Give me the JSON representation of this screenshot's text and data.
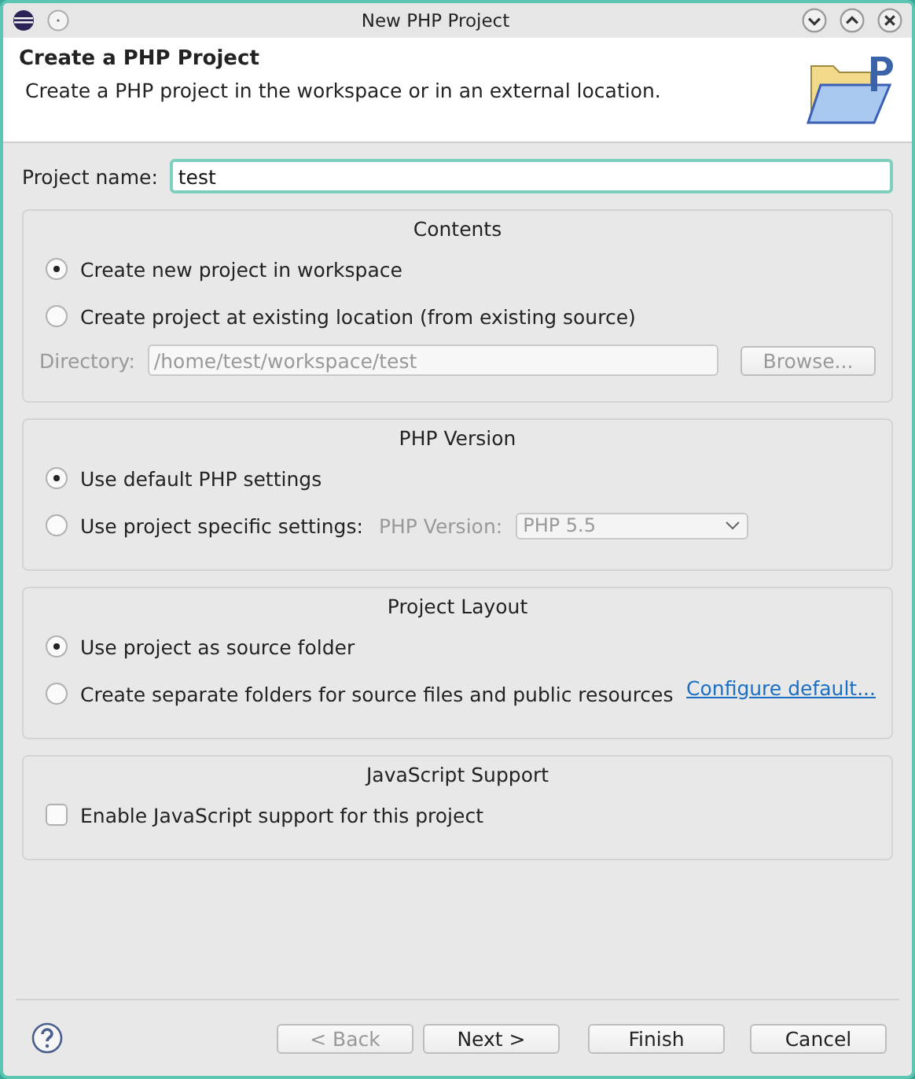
{
  "window": {
    "title": "New PHP Project"
  },
  "header": {
    "title": "Create a PHP Project",
    "description": "Create a PHP project in the workspace or in an external location."
  },
  "project_name": {
    "label": "Project name:",
    "value": "test"
  },
  "contents": {
    "title": "Contents",
    "options": [
      {
        "label": "Create new project in workspace",
        "selected": true
      },
      {
        "label": "Create project at existing location (from existing source)",
        "selected": false
      }
    ],
    "directory": {
      "label": "Directory:",
      "value": "/home/test/workspace/test",
      "disabled": true
    },
    "browse": {
      "label": "Browse...",
      "disabled": true
    }
  },
  "php_version": {
    "title": "PHP Version",
    "options": [
      {
        "label": "Use default PHP settings",
        "selected": true
      },
      {
        "label": "Use project specific settings:",
        "selected": false
      }
    ],
    "version_label": "PHP Version:",
    "version_value": "PHP 5.5",
    "version_disabled": true
  },
  "project_layout": {
    "title": "Project Layout",
    "options": [
      {
        "label": "Use project as source folder",
        "selected": true
      },
      {
        "label": "Create separate folders for source files and public resources",
        "selected": false
      }
    ],
    "link": "Configure default..."
  },
  "javascript": {
    "title": "JavaScript Support",
    "checkbox": {
      "label": "Enable JavaScript support for this project",
      "checked": false
    }
  },
  "buttons": [
    {
      "label": "< Back",
      "disabled": true
    },
    {
      "label": "Next >",
      "disabled": false
    },
    {
      "label": "Finish",
      "disabled": false
    },
    {
      "label": "Cancel",
      "disabled": false
    }
  ]
}
